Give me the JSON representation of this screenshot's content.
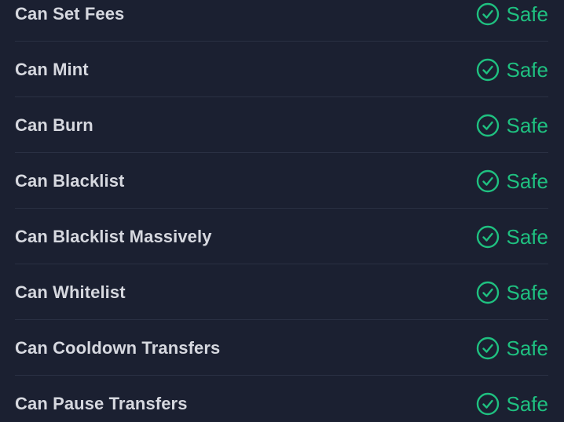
{
  "accent_color": "#1fc080",
  "status_icon": "check-circle-icon",
  "checks": [
    {
      "label": "Can Set Fees",
      "status": "Safe"
    },
    {
      "label": "Can Mint",
      "status": "Safe"
    },
    {
      "label": "Can Burn",
      "status": "Safe"
    },
    {
      "label": "Can Blacklist",
      "status": "Safe"
    },
    {
      "label": "Can Blacklist Massively",
      "status": "Safe"
    },
    {
      "label": "Can Whitelist",
      "status": "Safe"
    },
    {
      "label": "Can Cooldown Transfers",
      "status": "Safe"
    },
    {
      "label": "Can Pause Transfers",
      "status": "Safe"
    }
  ]
}
